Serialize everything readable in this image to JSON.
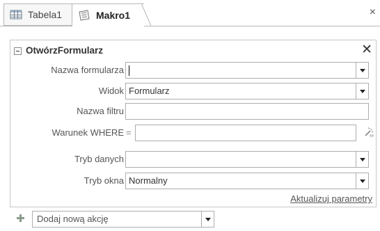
{
  "tabs": [
    {
      "label": "Tabela1",
      "icon": "table-icon"
    },
    {
      "label": "Makro1",
      "icon": "macro-icon"
    }
  ],
  "window_close": "×",
  "action": {
    "name": "OtwórzFormularz",
    "close_glyph": "✕",
    "rows": [
      {
        "label": "Nazwa formularza",
        "value": "",
        "type": "dropdown"
      },
      {
        "label": "Widok",
        "value": "Formularz",
        "type": "dropdown"
      },
      {
        "label": "Nazwa filtru",
        "value": "",
        "type": "text"
      },
      {
        "label": "Warunek WHERE",
        "prefix": "=",
        "value": "",
        "type": "expression"
      },
      {
        "label": "Tryb danych",
        "value": "",
        "type": "dropdown"
      },
      {
        "label": "Tryb okna",
        "value": "Normalny",
        "type": "dropdown"
      }
    ],
    "update_link": "Aktualizuj parametry"
  },
  "add_action": {
    "placeholder": "Dodaj nową akcję"
  }
}
